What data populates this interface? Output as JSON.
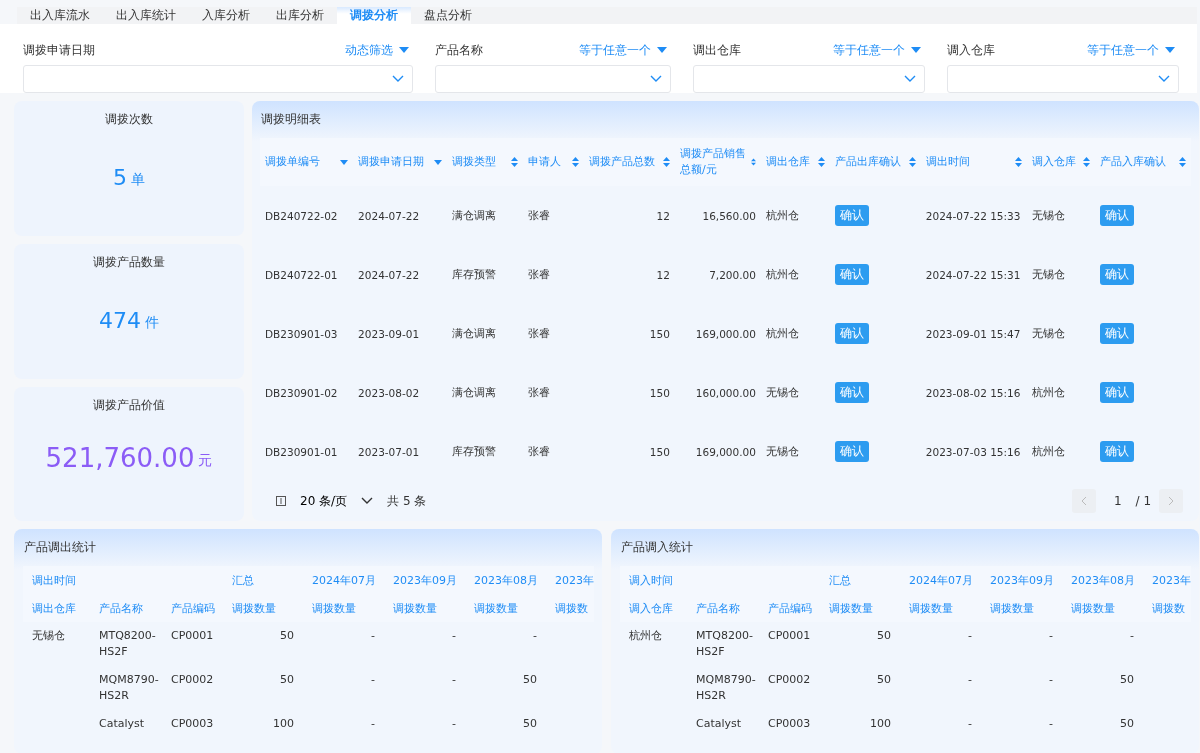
{
  "tabs": [
    {
      "label": "出入库流水",
      "selected": false
    },
    {
      "label": "出入库统计",
      "selected": false
    },
    {
      "label": "入库分析",
      "selected": false
    },
    {
      "label": "出库分析",
      "selected": false
    },
    {
      "label": "调拨分析",
      "selected": true
    },
    {
      "label": "盘点分析",
      "selected": false
    }
  ],
  "filters": [
    {
      "label": "调拨申请日期",
      "mode": "动态筛选"
    },
    {
      "label": "产品名称",
      "mode": "等于任意一个"
    },
    {
      "label": "调出仓库",
      "mode": "等于任意一个"
    },
    {
      "label": "调入仓库",
      "mode": "等于任意一个"
    }
  ],
  "stats": [
    {
      "label": "调拨次数",
      "value": "5",
      "unit": "单",
      "color": "#1e8cf5"
    },
    {
      "label": "调拨产品数量",
      "value": "474",
      "unit": "件",
      "color": "#1e8cf5"
    },
    {
      "label": "调拨产品价值",
      "value": "521,760.00",
      "unit": "元",
      "color": "#8b5cf6"
    }
  ],
  "detail": {
    "title": "调拨明细表",
    "columns": [
      {
        "label": "调拨单编号",
        "kind": "filter"
      },
      {
        "label": "调拨申请日期",
        "kind": "filter"
      },
      {
        "label": "调拨类型",
        "kind": "text"
      },
      {
        "label": "申请人",
        "kind": "text"
      },
      {
        "label": "调拨产品总数",
        "kind": "number"
      },
      {
        "label": "调拨产品销售总额/元",
        "kind": "number"
      },
      {
        "label": "调出仓库",
        "kind": "text"
      },
      {
        "label": "产品出库确认",
        "kind": "button"
      },
      {
        "label": "调出时间",
        "kind": "text"
      },
      {
        "label": "调入仓库",
        "kind": "text"
      },
      {
        "label": "产品入库确认",
        "kind": "button"
      }
    ],
    "rows": [
      [
        "DB240722-02",
        "2024-07-22",
        "满仓调离",
        "张睿",
        "12",
        "16,560.00",
        "杭州仓",
        "确认",
        "2024-07-22 15:33",
        "无锡仓",
        "确认"
      ],
      [
        "DB240722-01",
        "2024-07-22",
        "库存预警",
        "张睿",
        "12",
        "7,200.00",
        "杭州仓",
        "确认",
        "2024-07-22 15:31",
        "无锡仓",
        "确认"
      ],
      [
        "DB230901-03",
        "2023-09-01",
        "满仓调离",
        "张睿",
        "150",
        "169,000.00",
        "杭州仓",
        "确认",
        "2023-09-01 15:47",
        "无锡仓",
        "确认"
      ],
      [
        "DB230901-02",
        "2023-08-02",
        "满仓调离",
        "张睿",
        "150",
        "160,000.00",
        "无锡仓",
        "确认",
        "2023-08-02 15:16",
        "杭州仓",
        "确认"
      ],
      [
        "DB230901-01",
        "2023-07-01",
        "库存预警",
        "张睿",
        "150",
        "169,000.00",
        "无锡仓",
        "确认",
        "2023-07-03 15:16",
        "杭州仓",
        "确认"
      ]
    ],
    "pagination": {
      "page_size": "20 条/页",
      "total": "共 5 条",
      "page": "1",
      "pages": "/ 1"
    }
  },
  "summaries": [
    {
      "title": "产品调出统计",
      "header_top": [
        "调出时间",
        "汇总",
        "2024年07月",
        "2023年09月",
        "2023年08月",
        "2023年"
      ],
      "header_cols": [
        "调出仓库",
        "产品名称",
        "产品编码",
        "调拨数量",
        "调拨数量",
        "调拨数量",
        "调拨数量",
        "调拨数"
      ],
      "groups": [
        {
          "warehouse": "无锡仓",
          "items": [
            [
              "MTQ8200-HS2F",
              "CP0001",
              "50",
              "-",
              "-",
              "-"
            ],
            [
              "MQM8790-HS2R",
              "CP0002",
              "50",
              "-",
              "-",
              "50"
            ],
            [
              "Catalyst",
              "CP0003",
              "100",
              "-",
              "-",
              "50"
            ]
          ]
        }
      ]
    },
    {
      "title": "产品调入统计",
      "header_top": [
        "调入时间",
        "汇总",
        "2024年07月",
        "2023年09月",
        "2023年08月",
        "2023年"
      ],
      "header_cols": [
        "调入仓库",
        "产品名称",
        "产品编码",
        "调拨数量",
        "调拨数量",
        "调拨数量",
        "调拨数量",
        "调拨数"
      ],
      "groups": [
        {
          "warehouse": "杭州仓",
          "items": [
            [
              "MTQ8200-HS2F",
              "CP0001",
              "50",
              "-",
              "-",
              "-"
            ],
            [
              "MQM8790-HS2R",
              "CP0002",
              "50",
              "-",
              "-",
              "50"
            ],
            [
              "Catalyst",
              "CP0003",
              "100",
              "-",
              "-",
              "50"
            ]
          ]
        }
      ]
    }
  ]
}
